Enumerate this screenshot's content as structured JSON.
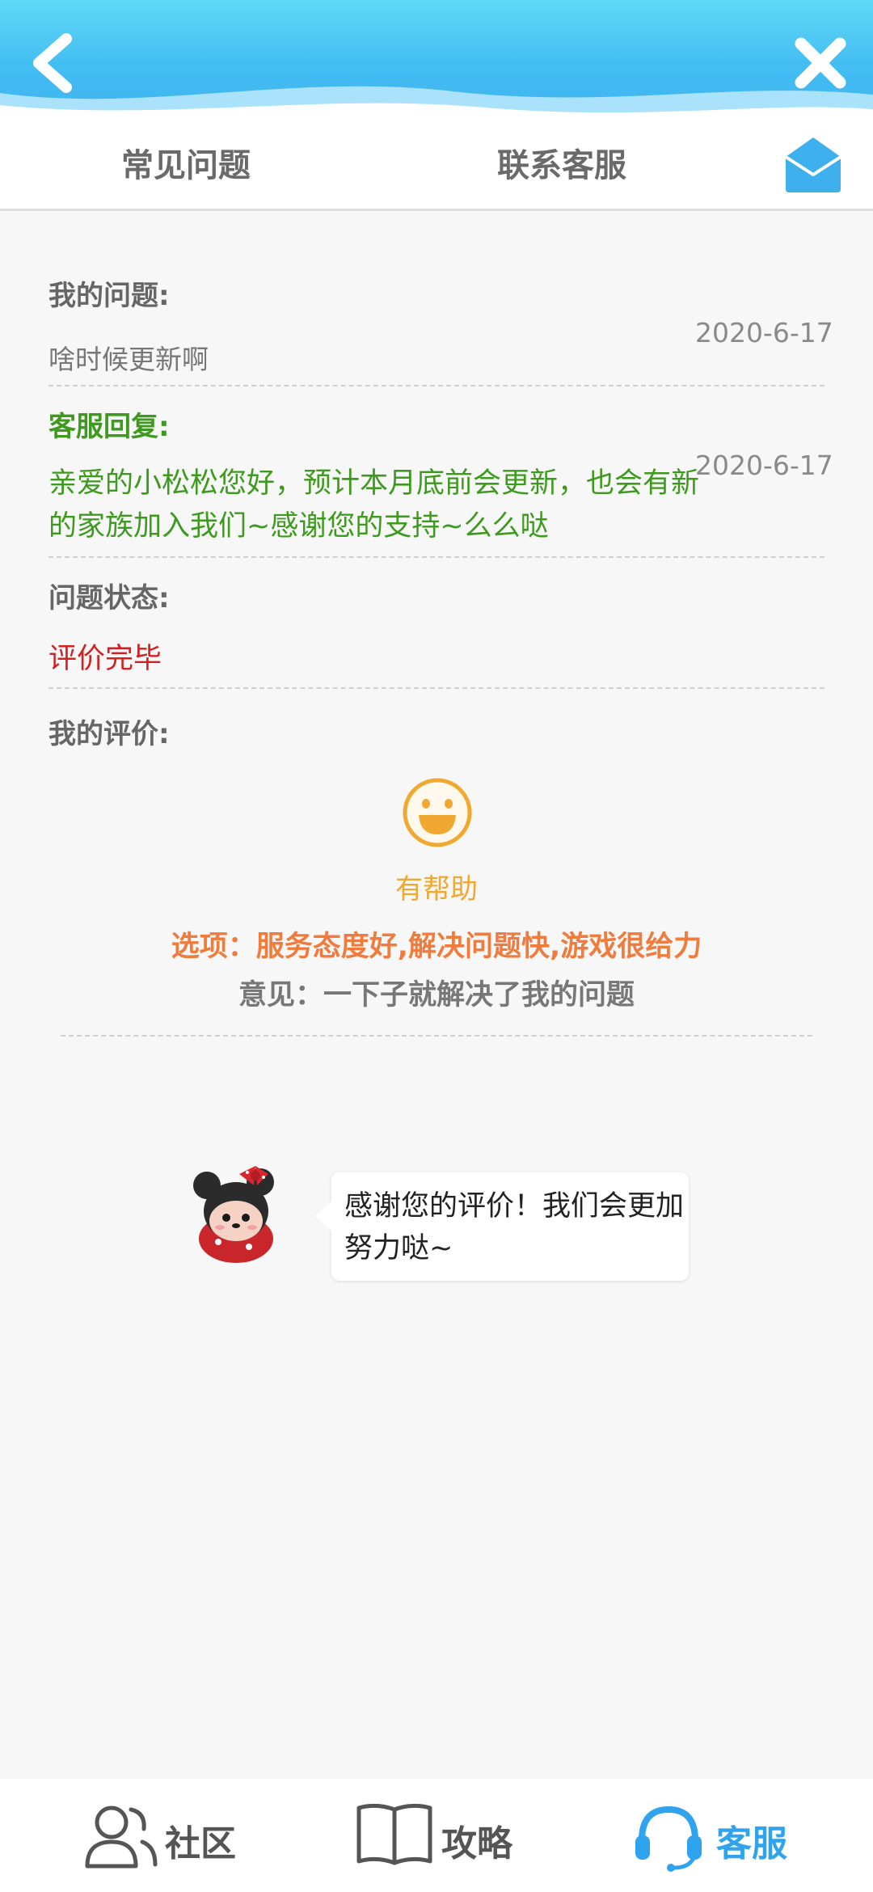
{
  "header": {
    "back_icon": "chevron-left-icon",
    "close_icon": "close-icon"
  },
  "tabs": {
    "faq": "常见问题",
    "contact": "联系客服",
    "mail_icon": "mail-icon"
  },
  "question": {
    "label": "我的问题:",
    "text": "啥时候更新啊",
    "date": "2020-6-17"
  },
  "reply": {
    "label": "客服回复:",
    "text": "亲爱的小松松您好，预计本月底前会更新，也会有新的家族加入我们~感谢您的支持~么么哒",
    "date": "2020-6-17"
  },
  "status": {
    "label": "问题状态:",
    "value": "评价完毕"
  },
  "evaluation": {
    "label": "我的评价:",
    "icon": "smile-icon",
    "result": "有帮助",
    "options": "选项：服务态度好,解决问题快,游戏很给力",
    "opinion": "意见：一下子就解决了我的问题"
  },
  "thanks": {
    "message": "感谢您的评价！我们会更加努力哒~"
  },
  "bottom_nav": {
    "community": "社区",
    "guide": "攻略",
    "service": "客服"
  },
  "colors": {
    "header_blue": "#43bdf2",
    "reply_green": "#3e9a1e",
    "status_red": "#d32020",
    "helpful_orange": "#f0a830",
    "options_orange": "#ef7b3c",
    "active_nav_blue": "#2fa3ee"
  }
}
